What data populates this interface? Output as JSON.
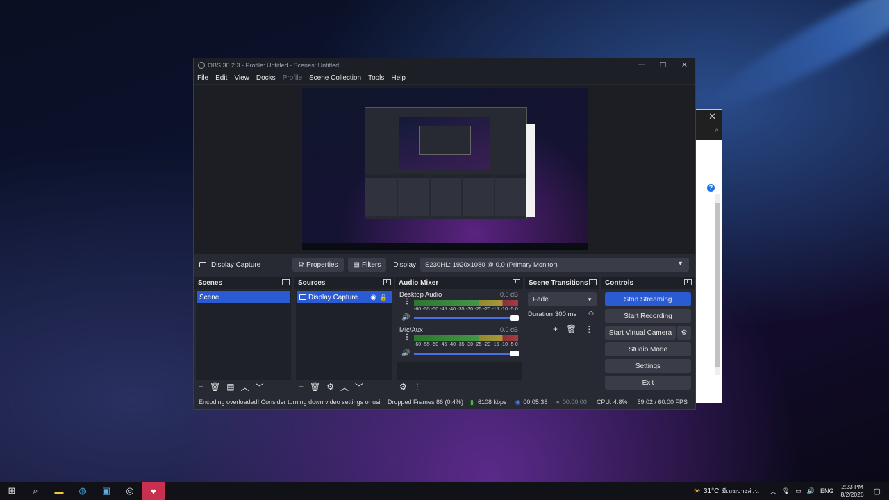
{
  "window": {
    "title": "OBS 30.2.3 - Profile: Untitled - Scenes: Untitled"
  },
  "menu": [
    "File",
    "Edit",
    "View",
    "Docks",
    "Profile",
    "Scene Collection",
    "Tools",
    "Help"
  ],
  "source_bar": {
    "source_name": "Display Capture",
    "properties": "Properties",
    "filters": "Filters",
    "display_label": "Display",
    "display_value": "S230HL: 1920x1080 @ 0,0 (Primary Monitor)"
  },
  "docks": {
    "scenes": {
      "title": "Scenes",
      "items": [
        "Scene"
      ]
    },
    "sources": {
      "title": "Sources",
      "items": [
        "Display Capture"
      ]
    },
    "mixer": {
      "title": "Audio Mixer",
      "channels": [
        {
          "name": "Desktop Audio",
          "db": "0.0 dB"
        },
        {
          "name": "Mic/Aux",
          "db": "0.0 dB"
        }
      ],
      "ticks": [
        "-60",
        "-55",
        "-50",
        "-45",
        "-40",
        "-35",
        "-30",
        "-25",
        "-20",
        "-15",
        "-10",
        "-5",
        "0"
      ]
    },
    "transitions": {
      "title": "Scene Transitions",
      "type": "Fade",
      "duration_label": "Duration",
      "duration_value": "300 ms"
    },
    "controls": {
      "title": "Controls",
      "stop_streaming": "Stop Streaming",
      "start_recording": "Start Recording",
      "start_virtual_camera": "Start Virtual Camera",
      "studio_mode": "Studio Mode",
      "settings": "Settings",
      "exit": "Exit"
    }
  },
  "status": {
    "message": "Encoding overloaded! Consider turning down video settings or usi",
    "dropped": "Dropped Frames 86 (0.4%)",
    "bitrate": "6108 kbps",
    "stream_time": "00:05:36",
    "rec_time": "00:00:00",
    "cpu": "CPU: 4.8%",
    "fps": "59.02 / 60.00 FPS"
  },
  "taskbar": {
    "weather": "31°C",
    "weather_desc": "มีเมฆบางส่วน",
    "lang": "ENG",
    "time": "2:23 PM",
    "date": "8/2/2026"
  },
  "colors": {
    "accent": "#2b5bd3",
    "dock_bg": "#272a33"
  }
}
